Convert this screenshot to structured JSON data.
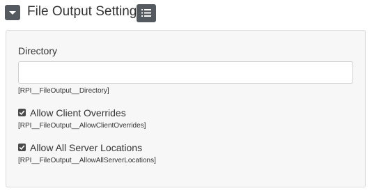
{
  "header": {
    "title": "File Output Settings",
    "collapse_icon": "caret-down-icon",
    "list_icon": "list-icon"
  },
  "fields": {
    "directory": {
      "label": "Directory",
      "value": "",
      "placeholder": "",
      "key": "[RPI__FileOutput__Directory]"
    },
    "allow_client_overrides": {
      "label": "Allow Client Overrides",
      "checked": true,
      "key": "[RPI__FileOutput__AllowClientOverrides]"
    },
    "allow_all_server_locations": {
      "label": "Allow All Server Locations",
      "checked": true,
      "key": "[RPI__FileOutput__AllowAllServerLocations]"
    }
  },
  "colors": {
    "button_bg": "#555a60",
    "panel_bg": "#f7f7f7",
    "panel_border": "#dcdcdc",
    "checkbox_bg": "#4a4a4a"
  }
}
